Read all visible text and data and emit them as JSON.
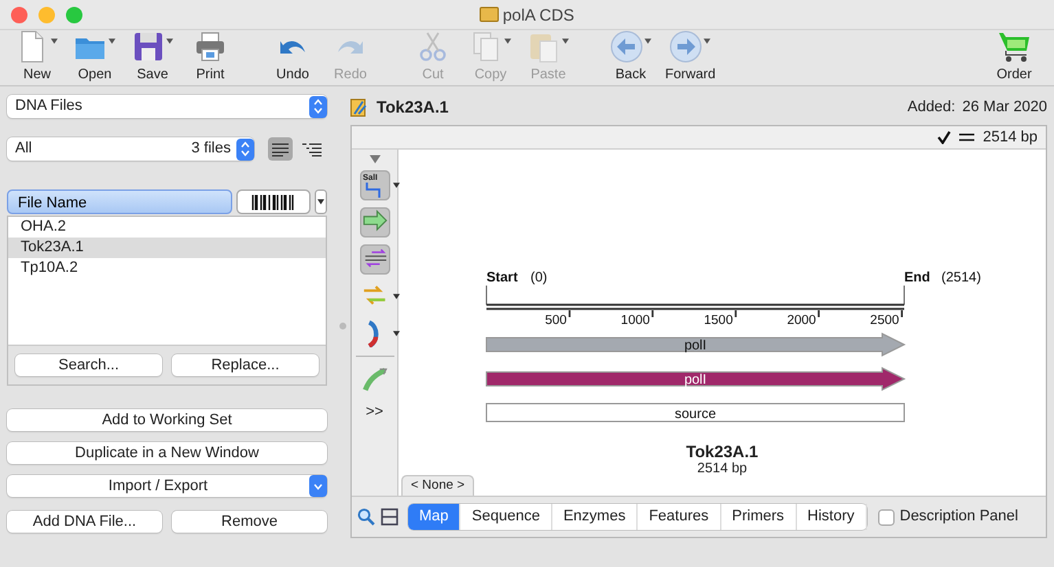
{
  "window": {
    "title": "polA CDS"
  },
  "toolbar": {
    "groups": [
      {
        "items": [
          {
            "label": "New",
            "kind": "new",
            "menu": true,
            "disabled": false
          },
          {
            "label": "Open",
            "kind": "open",
            "menu": true,
            "disabled": false
          },
          {
            "label": "Save",
            "kind": "save",
            "menu": true,
            "disabled": false
          },
          {
            "label": "Print",
            "kind": "print",
            "menu": false,
            "disabled": false
          }
        ]
      },
      {
        "items": [
          {
            "label": "Undo",
            "kind": "undo",
            "menu": false,
            "disabled": false
          },
          {
            "label": "Redo",
            "kind": "redo",
            "menu": false,
            "disabled": true
          }
        ]
      },
      {
        "items": [
          {
            "label": "Cut",
            "kind": "cut",
            "menu": false,
            "disabled": true
          },
          {
            "label": "Copy",
            "kind": "copy",
            "menu": true,
            "disabled": true
          },
          {
            "label": "Paste",
            "kind": "paste",
            "menu": true,
            "disabled": true
          }
        ]
      },
      {
        "items": [
          {
            "label": "Back",
            "kind": "back",
            "menu": true,
            "disabled": false
          },
          {
            "label": "Forward",
            "kind": "forward",
            "menu": true,
            "disabled": false
          }
        ]
      },
      {
        "items": [
          {
            "label": "Order",
            "kind": "order",
            "menu": false,
            "disabled": false
          }
        ]
      }
    ]
  },
  "sidebar": {
    "collection": "DNA Files",
    "filter": "All",
    "file_count": "3 files",
    "view_modes": [
      {
        "kind": "list",
        "selected": true
      },
      {
        "kind": "outline",
        "selected": false
      }
    ],
    "name_column": {
      "label": "File Name",
      "selected": true
    },
    "files": [
      {
        "name": "OHA.2",
        "selected": false
      },
      {
        "name": "Tok23A.1",
        "selected": true
      },
      {
        "name": "Tp10A.2",
        "selected": false
      }
    ],
    "list_buttons": [
      "Search...",
      "Replace..."
    ],
    "actions": [
      {
        "label": "Add to Working Set",
        "kind": "button"
      },
      {
        "label": "Duplicate in a New Window",
        "kind": "button"
      },
      {
        "label": "Import / Export",
        "kind": "dropdown"
      }
    ],
    "bottom_buttons": [
      "Add DNA File...",
      "Remove"
    ]
  },
  "document": {
    "name": "Tok23A.1",
    "added_label": "Added:",
    "added_date": "26 Mar 2020",
    "length": "2514 bp",
    "tools": [
      {
        "kind": "enzymes",
        "label": "SalI",
        "on": true,
        "menu": true
      },
      {
        "kind": "features",
        "on": true,
        "menu": false
      },
      {
        "kind": "strands",
        "on": true,
        "menu": false
      },
      {
        "kind": "primers",
        "on": false,
        "menu": true
      },
      {
        "kind": "orfs",
        "on": false,
        "menu": true
      },
      {
        "kind": "translate",
        "on": false,
        "menu": false
      }
    ],
    "more": ">>",
    "map": {
      "start_label": "Start",
      "start_value": "(0)",
      "end_label": "End",
      "end_value": "(2514)",
      "ticks": [
        "500",
        "1000",
        "1500",
        "2000",
        "2500"
      ],
      "features": [
        {
          "label": "polI",
          "kind": "arrow",
          "color": "#a4a9b0"
        },
        {
          "label": "polI",
          "kind": "arrow",
          "color": "#a0286a"
        },
        {
          "label": "source",
          "kind": "bar",
          "color": "#ffffff"
        }
      ],
      "title": "Tok23A.1",
      "subtitle": "2514 bp"
    },
    "annotation_tab": "< None >",
    "views": [
      {
        "label": "Map",
        "selected": true
      },
      {
        "label": "Sequence",
        "selected": false
      },
      {
        "label": "Enzymes",
        "selected": false
      },
      {
        "label": "Features",
        "selected": false
      },
      {
        "label": "Primers",
        "selected": false
      },
      {
        "label": "History",
        "selected": false
      }
    ],
    "description_panel": {
      "label": "Description Panel",
      "checked": false
    }
  }
}
